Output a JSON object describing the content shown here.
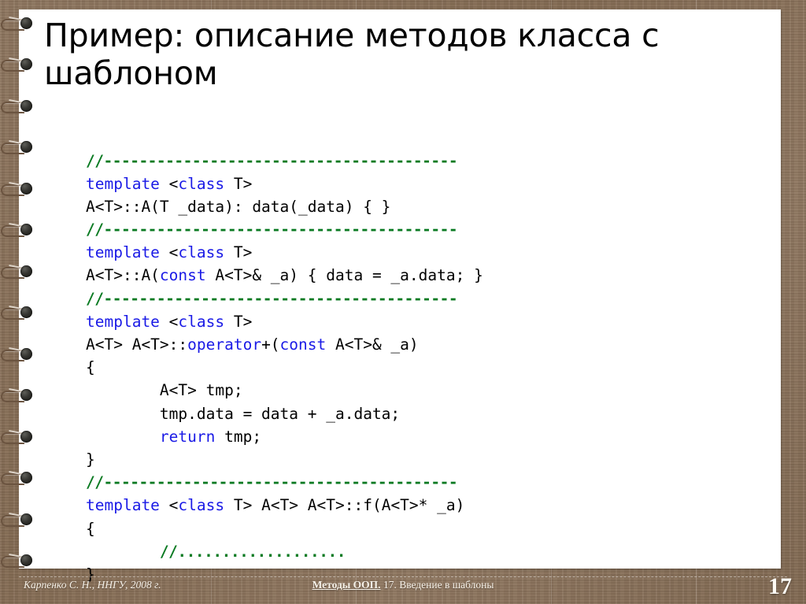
{
  "slide": {
    "title_line1": "Пример: описание методов класса с",
    "title_line2": "шаблоном",
    "background_color": "#8a7159",
    "page_color": "#ffffff"
  },
  "code": {
    "language": "cpp",
    "comment_color": "#0a7a22",
    "keyword_color": "#1a1ae6",
    "text_color": "#000000",
    "lines": [
      {
        "indent": 0,
        "tokens": [
          {
            "t": "//----------------------------------------",
            "c": "comment"
          }
        ]
      },
      {
        "indent": 0,
        "tokens": [
          {
            "t": "template ",
            "c": "keyword"
          },
          {
            "t": "<",
            "c": "plain"
          },
          {
            "t": "class",
            "c": "keyword"
          },
          {
            "t": " T>",
            "c": "plain"
          }
        ]
      },
      {
        "indent": 0,
        "tokens": [
          {
            "t": "A<T>::A(T _data): data(_data) { }",
            "c": "plain"
          }
        ]
      },
      {
        "indent": 0,
        "tokens": [
          {
            "t": "//----------------------------------------",
            "c": "comment"
          }
        ]
      },
      {
        "indent": 0,
        "tokens": [
          {
            "t": "template ",
            "c": "keyword"
          },
          {
            "t": "<",
            "c": "plain"
          },
          {
            "t": "class",
            "c": "keyword"
          },
          {
            "t": " T>",
            "c": "plain"
          }
        ]
      },
      {
        "indent": 0,
        "tokens": [
          {
            "t": "A<T>::A(",
            "c": "plain"
          },
          {
            "t": "const",
            "c": "keyword"
          },
          {
            "t": " A<T>& _a) { data = _a.data; }",
            "c": "plain"
          }
        ]
      },
      {
        "indent": 0,
        "tokens": [
          {
            "t": "//----------------------------------------",
            "c": "comment"
          }
        ]
      },
      {
        "indent": 0,
        "tokens": [
          {
            "t": "template ",
            "c": "keyword"
          },
          {
            "t": "<",
            "c": "plain"
          },
          {
            "t": "class",
            "c": "keyword"
          },
          {
            "t": " T>",
            "c": "plain"
          }
        ]
      },
      {
        "indent": 0,
        "tokens": [
          {
            "t": "A<T> A<T>::",
            "c": "plain"
          },
          {
            "t": "operator",
            "c": "keyword"
          },
          {
            "t": "+(",
            "c": "plain"
          },
          {
            "t": "const",
            "c": "keyword"
          },
          {
            "t": " A<T>& _a)",
            "c": "plain"
          }
        ]
      },
      {
        "indent": 0,
        "tokens": [
          {
            "t": "{",
            "c": "plain"
          }
        ]
      },
      {
        "indent": 1,
        "tokens": [
          {
            "t": "A<T> tmp;",
            "c": "plain"
          }
        ]
      },
      {
        "indent": 1,
        "tokens": [
          {
            "t": "tmp.data = data + _a.data;",
            "c": "plain"
          }
        ]
      },
      {
        "indent": 1,
        "tokens": [
          {
            "t": "return",
            "c": "keyword"
          },
          {
            "t": " tmp;",
            "c": "plain"
          }
        ]
      },
      {
        "indent": 0,
        "tokens": [
          {
            "t": "}",
            "c": "plain"
          }
        ]
      },
      {
        "indent": 0,
        "tokens": [
          {
            "t": "//----------------------------------------",
            "c": "comment"
          }
        ]
      },
      {
        "indent": 0,
        "tokens": [
          {
            "t": "template ",
            "c": "keyword"
          },
          {
            "t": "<",
            "c": "plain"
          },
          {
            "t": "class",
            "c": "keyword"
          },
          {
            "t": " T> A<T> A<T>::f(A<T>* _a)",
            "c": "plain"
          }
        ]
      },
      {
        "indent": 0,
        "tokens": [
          {
            "t": "{",
            "c": "plain"
          }
        ]
      },
      {
        "indent": 1,
        "tokens": [
          {
            "t": "//...................",
            "c": "comment"
          }
        ]
      },
      {
        "indent": 0,
        "tokens": [
          {
            "t": "}",
            "c": "plain"
          }
        ]
      }
    ]
  },
  "footer": {
    "author": "Карпенко С. Н., ННГУ, 2008 г.",
    "course": "Методы ООП.",
    "topic": " 17. Введение в шаблоны",
    "page_number": "17"
  },
  "binding": {
    "ring_count": 14,
    "ring_color": "#14140f"
  }
}
